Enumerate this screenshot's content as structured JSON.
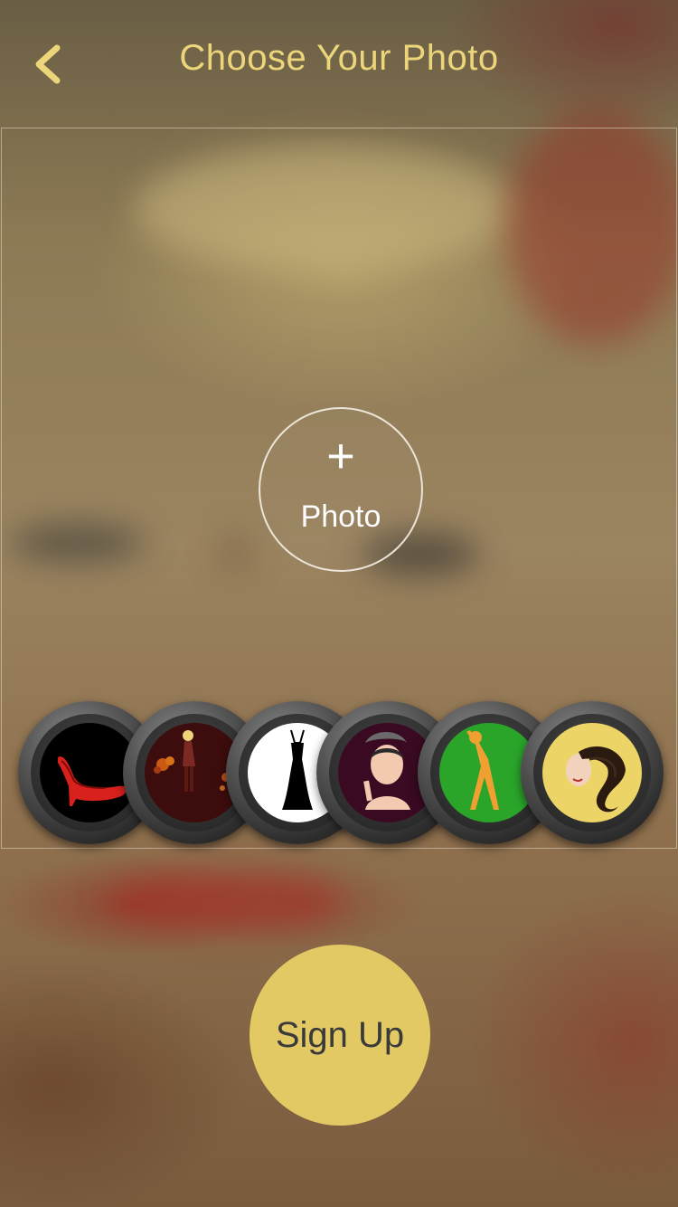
{
  "header": {
    "title": "Choose Your Photo",
    "back_icon": "chevron-left-icon"
  },
  "photo_picker": {
    "plus_symbol": "+",
    "label": "Photo"
  },
  "categories": [
    {
      "name": "high-heel-shoe",
      "icon": "high-heel-icon",
      "background": "#000000"
    },
    {
      "name": "autumn-fashion",
      "icon": "fashion-girl-icon",
      "background": "#3d0c0c"
    },
    {
      "name": "black-dress",
      "icon": "dress-icon",
      "background": "#ffffff"
    },
    {
      "name": "makeup",
      "icon": "makeup-woman-icon",
      "background": "#3a0a22"
    },
    {
      "name": "fitness",
      "icon": "fitness-pose-icon",
      "background": "#2aa52a"
    },
    {
      "name": "hair",
      "icon": "hair-woman-icon",
      "background": "#ecd466"
    }
  ],
  "signup": {
    "label": "Sign Up"
  },
  "colors": {
    "accent": "#ecd57a",
    "signup_button": "#e2c964"
  }
}
